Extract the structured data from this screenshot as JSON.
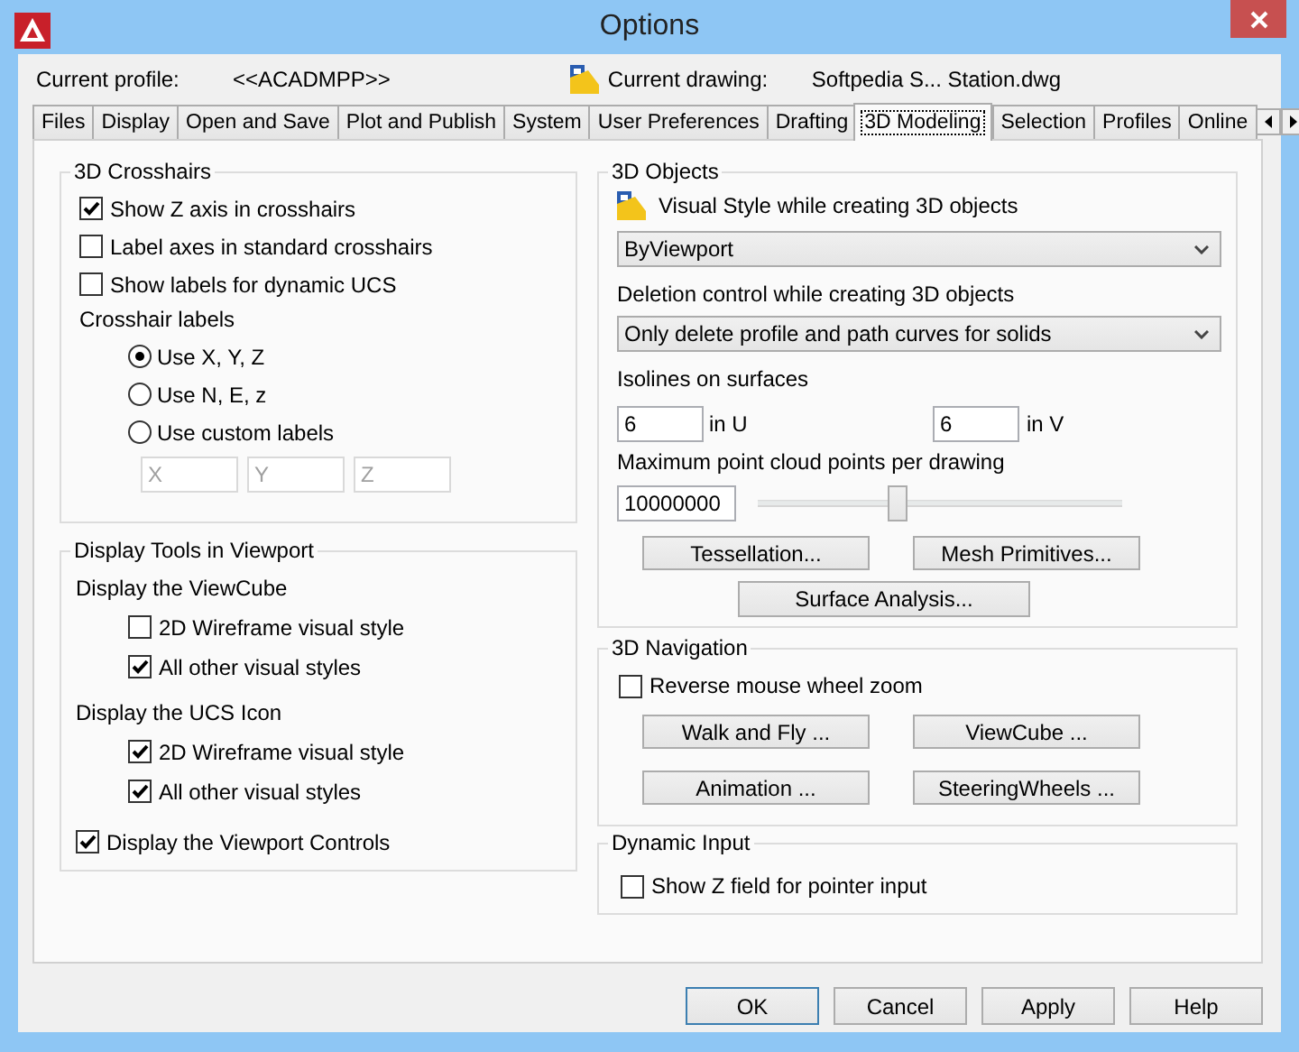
{
  "window": {
    "title": "Options"
  },
  "header": {
    "profile_label": "Current profile:",
    "profile": "<<ACADMPP>>",
    "drawing_label": "Current drawing:",
    "drawing": "Softpedia S... Station.dwg"
  },
  "tabs": [
    {
      "label": "Files",
      "selected": false
    },
    {
      "label": "Display",
      "selected": false
    },
    {
      "label": "Open and Save",
      "selected": false
    },
    {
      "label": "Plot and Publish",
      "selected": false
    },
    {
      "label": "System",
      "selected": false
    },
    {
      "label": "User Preferences",
      "selected": false
    },
    {
      "label": "Drafting",
      "selected": false
    },
    {
      "label": "3D Modeling",
      "selected": true
    },
    {
      "label": "Selection",
      "selected": false
    },
    {
      "label": "Profiles",
      "selected": false
    },
    {
      "label": "Online",
      "selected": false
    }
  ],
  "crosshairs": {
    "title": "3D Crosshairs",
    "options": [
      {
        "label": "Show Z axis in crosshairs",
        "checked": true
      },
      {
        "label": "Label axes in standard crosshairs",
        "checked": false
      },
      {
        "label": "Show labels for dynamic UCS",
        "checked": false
      }
    ],
    "labels_title": "Crosshair labels",
    "radios": [
      {
        "label": "Use X, Y, Z",
        "selected": true
      },
      {
        "label": "Use N, E, z",
        "selected": false
      },
      {
        "label": "Use custom labels",
        "selected": false
      }
    ],
    "custom_fields": [
      {
        "value": "X",
        "disabled": true
      },
      {
        "value": "Y",
        "disabled": true
      },
      {
        "value": "Z",
        "disabled": true
      }
    ]
  },
  "display_tools": {
    "title": "Display Tools in Viewport",
    "sections": [
      {
        "heading": "Display the ViewCube",
        "options": [
          {
            "label": "2D Wireframe visual style",
            "checked": false
          },
          {
            "label": "All other visual styles",
            "checked": true
          }
        ]
      },
      {
        "heading": "Display the UCS Icon",
        "options": [
          {
            "label": "2D Wireframe visual style",
            "checked": true
          },
          {
            "label": "All other visual styles",
            "checked": true
          }
        ]
      }
    ],
    "viewport_controls": {
      "label": "Display the Viewport Controls",
      "checked": true
    }
  },
  "objects": {
    "title": "3D Objects",
    "visual_style_label": "Visual Style while creating 3D objects",
    "visual_style": "ByViewport",
    "deletion_label": "Deletion control while creating 3D objects",
    "deletion": "Only delete profile and path curves for solids",
    "isolines_label": "Isolines on surfaces",
    "u_value": "6",
    "u_label": "in U",
    "v_value": "6",
    "v_label": "in V",
    "point_cloud_label": "Maximum point cloud points per drawing",
    "point_cloud_value": "10000000",
    "point_cloud_slider": {
      "level": 0.38
    },
    "buttons": [
      "Tessellation...",
      "Mesh Primitives...",
      "Surface Analysis..."
    ]
  },
  "navigation": {
    "title": "3D Navigation",
    "reverse_zoom": {
      "label": "Reverse mouse wheel zoom",
      "checked": false
    },
    "buttons": [
      "Walk and Fly ...",
      "ViewCube ...",
      "Animation ...",
      "SteeringWheels ..."
    ]
  },
  "dynamic_input": {
    "title": "Dynamic Input",
    "show_z": {
      "label": "Show Z field for pointer input",
      "checked": false
    }
  },
  "buttons": [
    {
      "label": "OK",
      "default": true
    },
    {
      "label": "Cancel",
      "default": false
    },
    {
      "label": "Apply",
      "default": false
    },
    {
      "label": "Help",
      "default": false
    }
  ]
}
